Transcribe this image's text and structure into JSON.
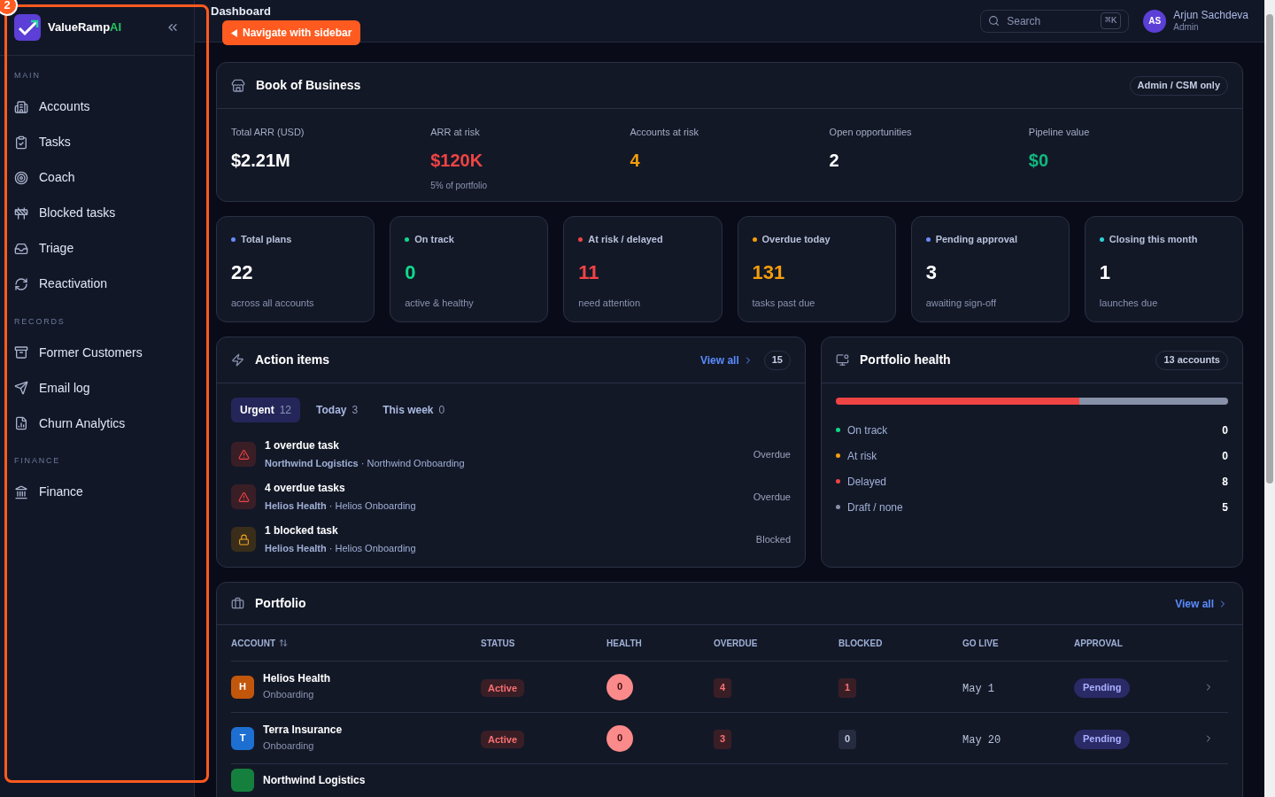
{
  "tour": {
    "step": "2",
    "tooltip": "Navigate with sidebar"
  },
  "sidebar": {
    "brand": {
      "name": "ValueRamp",
      "accent": "AI"
    },
    "sections": [
      {
        "title": "MAIN",
        "items": [
          {
            "label": "Accounts"
          },
          {
            "label": "Tasks"
          },
          {
            "label": "Coach"
          },
          {
            "label": "Blocked tasks"
          },
          {
            "label": "Triage"
          },
          {
            "label": "Reactivation"
          }
        ]
      },
      {
        "title": "RECORDS",
        "items": [
          {
            "label": "Former Customers"
          },
          {
            "label": "Email log"
          },
          {
            "label": "Churn Analytics"
          }
        ]
      },
      {
        "title": "FINANCE",
        "items": [
          {
            "label": "Finance"
          }
        ]
      }
    ]
  },
  "header": {
    "title": "Dashboard",
    "search": {
      "placeholder": "Search",
      "shortcut": "⌘K"
    },
    "user": {
      "initials": "AS",
      "name": "Arjun Sachdeva",
      "role": "Admin"
    }
  },
  "book": {
    "title": "Book of Business",
    "badge": "Admin / CSM only",
    "metrics": [
      {
        "label": "Total ARR (USD)",
        "value": "$2.21M",
        "color": "#ffffff"
      },
      {
        "label": "ARR at risk",
        "value": "$120K",
        "color": "#ef4444",
        "note": "5% of portfolio"
      },
      {
        "label": "Accounts at risk",
        "value": "4",
        "color": "#f59e0b"
      },
      {
        "label": "Open opportunities",
        "value": "2",
        "color": "#ffffff"
      },
      {
        "label": "Pipeline value",
        "value": "$0",
        "color": "#10b981"
      }
    ]
  },
  "stats": [
    {
      "label": "Total plans",
      "value": "22",
      "note": "across all accounts",
      "color": "#6b8cff",
      "kind": "plain"
    },
    {
      "label": "On track",
      "value": "0",
      "note": "active & healthy",
      "color": "#10d98a",
      "kind": "highlight"
    },
    {
      "label": "At risk / delayed",
      "value": "11",
      "note": "need attention",
      "color": "#ef4444",
      "kind": "highlight"
    },
    {
      "label": "Overdue today",
      "value": "131",
      "note": "tasks past due",
      "color": "#f59e0b",
      "kind": "highlight"
    },
    {
      "label": "Pending approval",
      "value": "3",
      "note": "awaiting sign-off",
      "color": "#6b8cff",
      "kind": "plain"
    },
    {
      "label": "Closing this month",
      "value": "1",
      "note": "launches due",
      "color": "#2dd4d4",
      "kind": "plain"
    }
  ],
  "action_items": {
    "title": "Action items",
    "separator": "·",
    "view_all": "View all",
    "count": "15",
    "tabs": [
      {
        "label": "Urgent",
        "count": "12",
        "selected": true
      },
      {
        "label": "Today",
        "count": "3",
        "selected": false
      },
      {
        "label": "This week",
        "count": "0",
        "selected": false
      }
    ],
    "items": [
      {
        "kind": "overdue",
        "title": "1 overdue task",
        "account": "Northwind Logistics",
        "plan": "Northwind Onboarding",
        "status": "Overdue"
      },
      {
        "kind": "overdue",
        "title": "4 overdue tasks",
        "account": "Helios Health",
        "plan": "Helios Onboarding",
        "status": "Overdue"
      },
      {
        "kind": "blocked",
        "title": "1 blocked task",
        "account": "Helios Health",
        "plan": "Helios Onboarding",
        "status": "Blocked"
      }
    ]
  },
  "portfolio_health": {
    "title": "Portfolio health",
    "badge": "13 accounts",
    "bar": [
      {
        "color": "#ef4444",
        "level": 0.62
      },
      {
        "color": "#8791a8",
        "level": 0.38
      }
    ],
    "legend": [
      {
        "label": "On track",
        "value": "0",
        "color": "#10d98a"
      },
      {
        "label": "At risk",
        "value": "0",
        "color": "#f59e0b"
      },
      {
        "label": "Delayed",
        "value": "8",
        "color": "#ef4444"
      },
      {
        "label": "Draft / none",
        "value": "5",
        "color": "#8791a8"
      }
    ]
  },
  "portfolio": {
    "title": "Portfolio",
    "view_all": "View all",
    "columns": [
      "ACCOUNT",
      "STATUS",
      "HEALTH",
      "OVERDUE",
      "BLOCKED",
      "GO LIVE",
      "APPROVAL"
    ],
    "rows": [
      {
        "avatar": "H",
        "color": "#c2570c",
        "name": "Helios Health",
        "stage": "Onboarding",
        "status": "Active",
        "health": "0",
        "overdue": {
          "text": "4",
          "flagged": true
        },
        "blocked": {
          "text": "1",
          "flagged": true
        },
        "go_live": "May 1",
        "approval": "Pending"
      },
      {
        "avatar": "T",
        "color": "#1d6fd1",
        "name": "Terra Insurance",
        "stage": "Onboarding",
        "status": "Active",
        "health": "0",
        "overdue": {
          "text": "3",
          "flagged": true
        },
        "blocked": {
          "text": "0",
          "flagged": false
        },
        "go_live": "May 20",
        "approval": "Pending"
      },
      {
        "color": "#15803d",
        "name": "Northwind Logistics"
      }
    ]
  }
}
